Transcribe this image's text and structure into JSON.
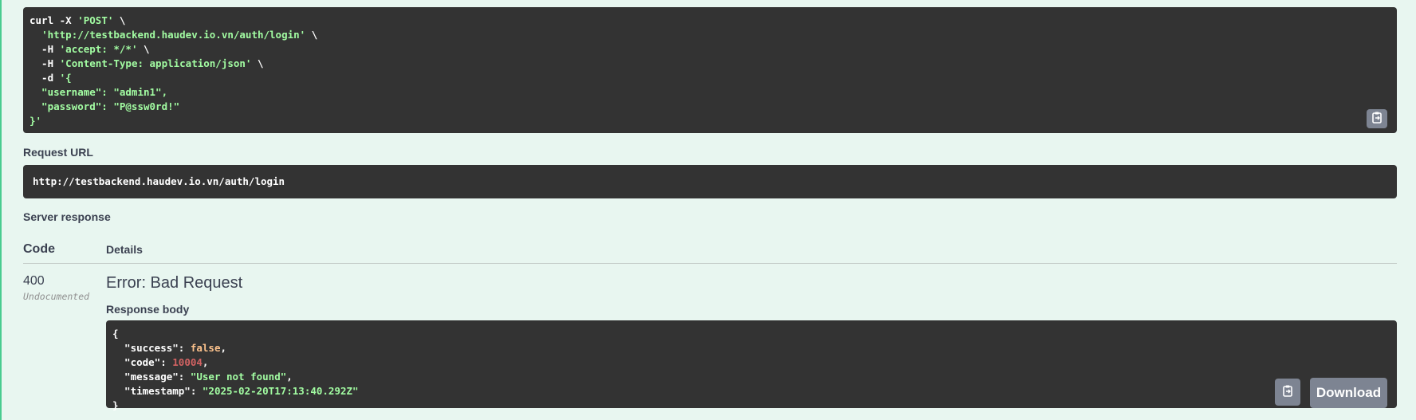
{
  "curl": {
    "lines": [
      {
        "parts": [
          {
            "t": "curl -X ",
            "c": ""
          },
          {
            "t": "'POST'",
            "c": "str"
          },
          {
            "t": " \\",
            "c": ""
          }
        ]
      },
      {
        "parts": [
          {
            "t": "  ",
            "c": ""
          },
          {
            "t": "'http://testbackend.haudev.io.vn/auth/login'",
            "c": "str"
          },
          {
            "t": " \\",
            "c": ""
          }
        ]
      },
      {
        "parts": [
          {
            "t": "  -H ",
            "c": ""
          },
          {
            "t": "'accept: */*'",
            "c": "str"
          },
          {
            "t": " \\",
            "c": ""
          }
        ]
      },
      {
        "parts": [
          {
            "t": "  -H ",
            "c": ""
          },
          {
            "t": "'Content-Type: application/json'",
            "c": "str"
          },
          {
            "t": " \\",
            "c": ""
          }
        ]
      },
      {
        "parts": [
          {
            "t": "  -d ",
            "c": ""
          },
          {
            "t": "'{",
            "c": "str"
          }
        ]
      },
      {
        "parts": [
          {
            "t": "  \"username\": \"admin1\",",
            "c": "str"
          }
        ]
      },
      {
        "parts": [
          {
            "t": "  \"password\": \"P@ssw0rd!\"",
            "c": "str"
          }
        ]
      },
      {
        "parts": [
          {
            "t": "}'",
            "c": "str"
          }
        ]
      }
    ]
  },
  "request_url": {
    "label": "Request URL",
    "value": "http://testbackend.haudev.io.vn/auth/login"
  },
  "server_response": {
    "label": "Server response",
    "col_code": "Code",
    "col_details": "Details",
    "status_code": "400",
    "status_note": "Undocumented",
    "error_title": "Error: Bad Request",
    "response_body_label": "Response body",
    "body_lines": [
      {
        "parts": [
          {
            "t": "{",
            "c": ""
          }
        ]
      },
      {
        "parts": [
          {
            "t": "  \"success\": ",
            "c": ""
          },
          {
            "t": "false",
            "c": "kw"
          },
          {
            "t": ",",
            "c": ""
          }
        ]
      },
      {
        "parts": [
          {
            "t": "  \"code\": ",
            "c": ""
          },
          {
            "t": "10004",
            "c": "num"
          },
          {
            "t": ",",
            "c": ""
          }
        ]
      },
      {
        "parts": [
          {
            "t": "  \"message\": ",
            "c": ""
          },
          {
            "t": "\"User not found\"",
            "c": "str"
          },
          {
            "t": ",",
            "c": ""
          }
        ]
      },
      {
        "parts": [
          {
            "t": "  \"timestamp\": ",
            "c": ""
          },
          {
            "t": "\"2025-02-20T17:13:40.292Z\"",
            "c": "str"
          }
        ]
      },
      {
        "parts": [
          {
            "t": "}",
            "c": ""
          }
        ]
      }
    ],
    "download_label": "Download"
  },
  "icons": {
    "copy": "clipboard-copy-icon"
  },
  "colors": {
    "background": "#e8f6f0",
    "accent": "#49cc90",
    "code_bg": "#333333",
    "string": "#a2fca2",
    "keyword": "#fcc28c",
    "number": "#d36363",
    "button": "#7d8492"
  }
}
